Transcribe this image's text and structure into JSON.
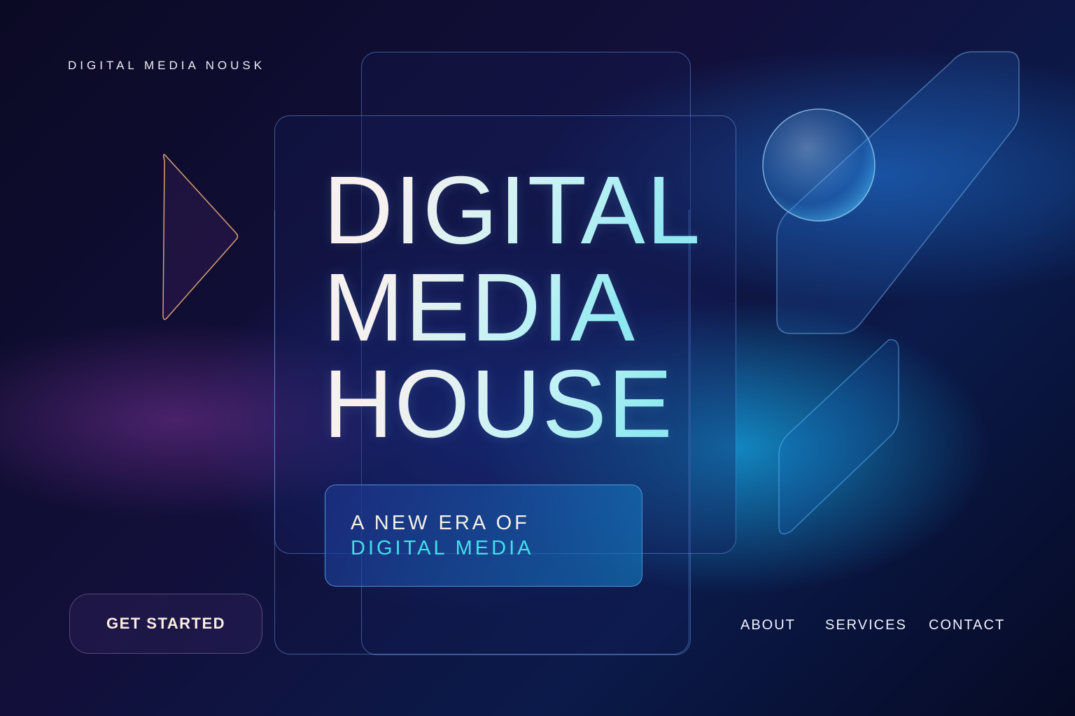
{
  "brand": "DIGITAL MEDIA NOUSK",
  "hero": {
    "line1": "DIGITAL",
    "line2": "MEDIA",
    "line3": "HOUSE"
  },
  "subtitle": {
    "line1": "A NEW ERA OF",
    "line2": "DIGITAL MEDIA"
  },
  "cta": "GET STARTED",
  "nav": [
    "ABOUT",
    "SERVICES",
    "CONTACT"
  ]
}
